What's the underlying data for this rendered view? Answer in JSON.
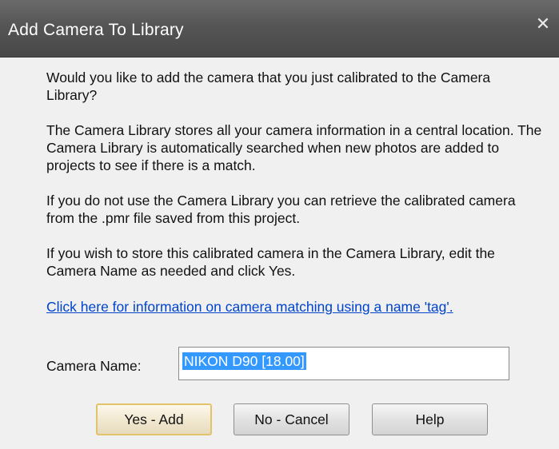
{
  "window": {
    "title": "Add Camera To Library",
    "close_glyph": "✕"
  },
  "body": {
    "paragraph1": "Would you like to add the camera that you just calibrated to the Camera Library?",
    "paragraph2": "The Camera Library stores all your camera information in a central location. The Camera Library is automatically searched when new photos are added to projects to see if there is a match.",
    "paragraph3": "If you do not use the Camera Library you can retrieve the calibrated camera from the .pmr file saved from this project.",
    "paragraph4": "If you wish to store this calibrated camera in the Camera Library, edit the Camera Name as needed and click Yes.",
    "link_text": "Click here for information on camera matching using a name 'tag'."
  },
  "form": {
    "camera_name_label": "Camera Name:",
    "camera_name_value": "NIKON D90 [18.00]"
  },
  "buttons": {
    "yes_label": "Yes - Add",
    "no_label": "No - Cancel",
    "help_label": "Help"
  },
  "colors": {
    "titlebar": "#555555",
    "link": "#0044cc",
    "selection": "#3399ff",
    "default_button_border": "#e3c36a"
  },
  "icons": {
    "close": "close-icon"
  }
}
